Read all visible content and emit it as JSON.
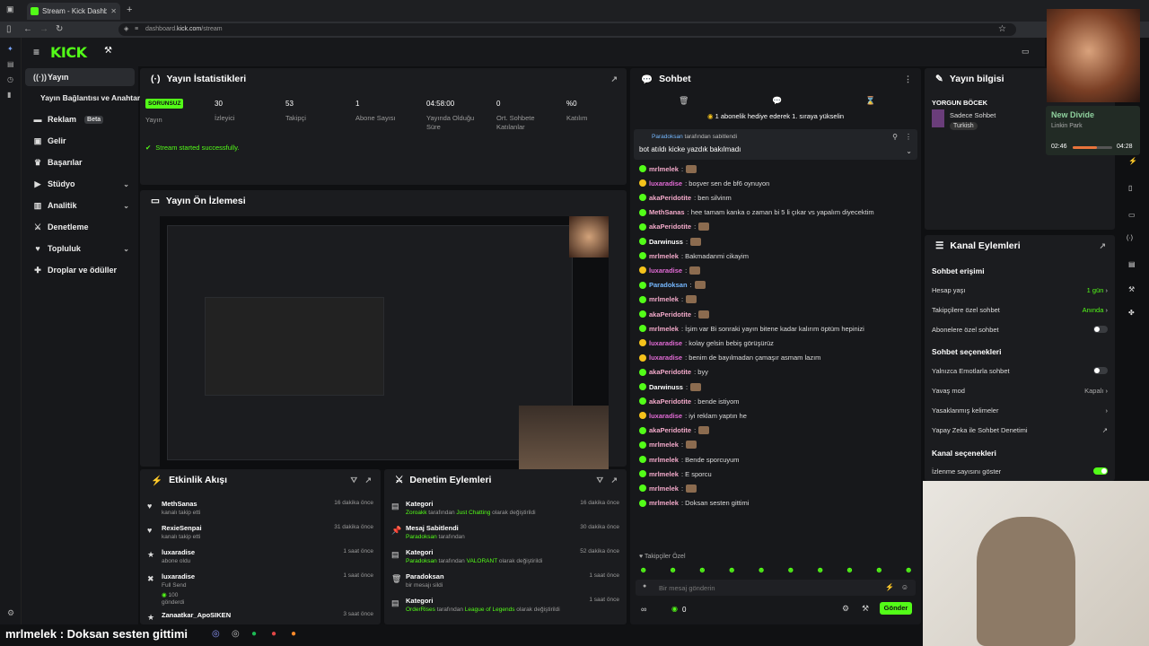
{
  "browser": {
    "tab_title": "Stream - Kick Dashboard",
    "url_prefix": "dashboard.",
    "url_domain": "kick.com",
    "url_path": "/stream"
  },
  "header": {
    "logo": "KICK"
  },
  "sidebar": {
    "items": [
      {
        "label": "Yayın"
      },
      {
        "label": "Yayın Bağlantısı ve Anahtarı"
      },
      {
        "label": "Reklam",
        "badge": "Beta"
      },
      {
        "label": "Gelir"
      },
      {
        "label": "Başarılar"
      },
      {
        "label": "Stüdyo"
      },
      {
        "label": "Analitik"
      },
      {
        "label": "Denetleme"
      },
      {
        "label": "Topluluk"
      },
      {
        "label": "Droplar ve ödüller"
      }
    ]
  },
  "stats": {
    "title": "Yayın İstatistikleri",
    "badge": "SORUNSUZ",
    "badge_label": "Yayın",
    "items": [
      {
        "value": "30",
        "label": "İzleyici"
      },
      {
        "value": "53",
        "label": "Takipçi"
      },
      {
        "value": "1",
        "label": "Abone Sayısı"
      },
      {
        "value": "04:58:00",
        "label": "Yayında Olduğu Süre"
      },
      {
        "value": "0",
        "label": "Ort. Sohbete Katılanlar"
      },
      {
        "value": "%0",
        "label": "Katılım"
      }
    ],
    "status_msg": "Stream started successfully."
  },
  "preview": {
    "title": "Yayın Ön İzlemesi"
  },
  "activity": {
    "title": "Etkinlik Akışı",
    "items": [
      {
        "name": "MethSanas",
        "sub": "kanalı takip etti",
        "time": "16 dakika önce"
      },
      {
        "name": "RexieSenpai",
        "sub": "kanalı takip etti",
        "time": "31 dakika önce"
      },
      {
        "name": "luxaradise",
        "sub": "abone oldu",
        "time": "1 saat önce"
      },
      {
        "name": "luxaradise",
        "sub": "Full Send",
        "sub2": "100",
        "sub3": "gönderdi",
        "time": "1 saat önce"
      },
      {
        "name": "Zanaatkar_ApoSIKEN",
        "sub": "",
        "time": "3 saat önce"
      }
    ]
  },
  "moderation": {
    "title": "Denetim Eylemleri",
    "items": [
      {
        "name": "Kategori",
        "user": "Zoroakk",
        "mid": "tarafından",
        "target": "Just Chatting",
        "end": "olarak değiştirildi",
        "time": "16 dakika önce"
      },
      {
        "name": "Mesaj Sabitlendi",
        "user": "Paradoksan",
        "mid": "tarafından",
        "target": "",
        "end": "",
        "time": "30 dakika önce"
      },
      {
        "name": "Kategori",
        "user": "Paradoksan",
        "mid": "tarafından",
        "target": "VALORANT",
        "end": "olarak değiştirildi",
        "time": "52 dakika önce"
      },
      {
        "name": "Paradoksan",
        "user": "",
        "mid": "bir mesajı sildi",
        "target": "",
        "end": "",
        "time": "1 saat önce"
      },
      {
        "name": "Kategori",
        "user": "OrderRises",
        "mid": "tarafından",
        "target": "League of Legends",
        "end": "olarak değiştirildi",
        "time": "1 saat önce"
      }
    ]
  },
  "chat": {
    "title": "Sohbet",
    "gift_banner": "1 abonelik hediye ederek 1. sıraya yükselin",
    "pinned_by": "Paradoksan",
    "pinned_suffix": "tarafından sabitlendi",
    "pinned_msg": "bot atıldı kicke yazdık bakılmadı",
    "messages": [
      {
        "user": "mrlmelek",
        "text": ":",
        "color": "#f2a9c9"
      },
      {
        "user": "luxaradise",
        "text": ": boşver sen de bf6 oynuyon",
        "color": "#e26bd6"
      },
      {
        "user": "akaPeridotite",
        "text": ": ben silvinm",
        "color": "#f2a9c9"
      },
      {
        "user": "MethSanas",
        "text": ": hee tamam kanka o zaman bi 5 li çıkar vs yapalım diyecektim",
        "color": "#f2a9c9"
      },
      {
        "user": "akaPeridotite",
        "text": ":",
        "color": "#f2a9c9"
      },
      {
        "user": "Darwinuss",
        "text": ":",
        "color": "#ffffff"
      },
      {
        "user": "mrlmelek",
        "text": ": Bakmadanmi cikayim",
        "color": "#f2a9c9"
      },
      {
        "user": "luxaradise",
        "text": ":",
        "color": "#e26bd6"
      },
      {
        "user": "Paradoksan",
        "text": ":",
        "color": "#75b8ff"
      },
      {
        "user": "mrlmelek",
        "text": ":",
        "color": "#f2a9c9"
      },
      {
        "user": "akaPeridotite",
        "text": ":",
        "color": "#f2a9c9"
      },
      {
        "user": "mrlmelek",
        "text": ": İşim var Bi sonraki yayın bitene kadar kalırım öptüm hepinizi",
        "color": "#f2a9c9"
      },
      {
        "user": "luxaradise",
        "text": ": kolay gelsin bebiş görüşürüz",
        "color": "#e26bd6"
      },
      {
        "user": "luxaradise",
        "text": ": benim de bayılmadan çamaşır asmam lazım",
        "color": "#e26bd6"
      },
      {
        "user": "akaPeridotite",
        "text": ": byy",
        "color": "#f2a9c9"
      },
      {
        "user": "Darwinuss",
        "text": ":",
        "color": "#ffffff"
      },
      {
        "user": "akaPeridotite",
        "text": ": bende istiyom",
        "color": "#f2a9c9"
      },
      {
        "user": "luxaradise",
        "text": ": iyi reklam yaptın he",
        "color": "#e26bd6"
      },
      {
        "user": "akaPeridotite",
        "text": ":",
        "color": "#f2a9c9"
      },
      {
        "user": "mrlmelek",
        "text": ":",
        "color": "#f2a9c9"
      },
      {
        "user": "mrlmelek",
        "text": ": Bende sporcuyum",
        "color": "#f2a9c9"
      },
      {
        "user": "mrlmelek",
        "text": ": E sporcu",
        "color": "#f2a9c9"
      },
      {
        "user": "mrlmelek",
        "text": ":",
        "color": "#f2a9c9"
      },
      {
        "user": "mrlmelek",
        "text": ": Doksan sesten gittimi",
        "color": "#f2a9c9"
      }
    ],
    "followers_only": "Takipçiler Özel",
    "input_placeholder": "Bir mesaj gönderin",
    "send_label": "Gönder",
    "count": "0"
  },
  "stream_info": {
    "title": "Yayın bilgisi",
    "stream_name": "YORGUN BÖCEK",
    "category": "Sadece Sohbet",
    "language": "Turkish"
  },
  "channel_actions": {
    "title": "Kanal Eylemleri",
    "sections": {
      "access": "Sohbet erişimi",
      "options": "Sohbet seçenekleri",
      "channel": "Kanal seçenekleri"
    },
    "rows": {
      "account_age": {
        "label": "Hesap yaşı",
        "value": "1 gün"
      },
      "followers_only": {
        "label": "Takipçilere özel sohbet",
        "value": "Anında"
      },
      "subs_only": {
        "label": "Abonelere özel sohbet"
      },
      "emote_only": {
        "label": "Yalnızca Emotlarla sohbet"
      },
      "slow_mode": {
        "label": "Yavaş mod",
        "value": "Kapalı"
      },
      "banned_words": {
        "label": "Yasaklanmış kelimeler"
      },
      "ai_mod": {
        "label": "Yapay Zeka ile Sohbet Denetimi"
      },
      "viewer_count": {
        "label": "İzlenme sayısını göster"
      }
    }
  },
  "music": {
    "song": "New Divide",
    "artist": "Linkin Park",
    "elapsed": "02:46",
    "total": "04:28",
    "progress": 0.62
  },
  "overlay": {
    "caption": "mrlmelek : Doksan sesten gittimi"
  },
  "colors": {
    "accent": "#53fc18"
  }
}
